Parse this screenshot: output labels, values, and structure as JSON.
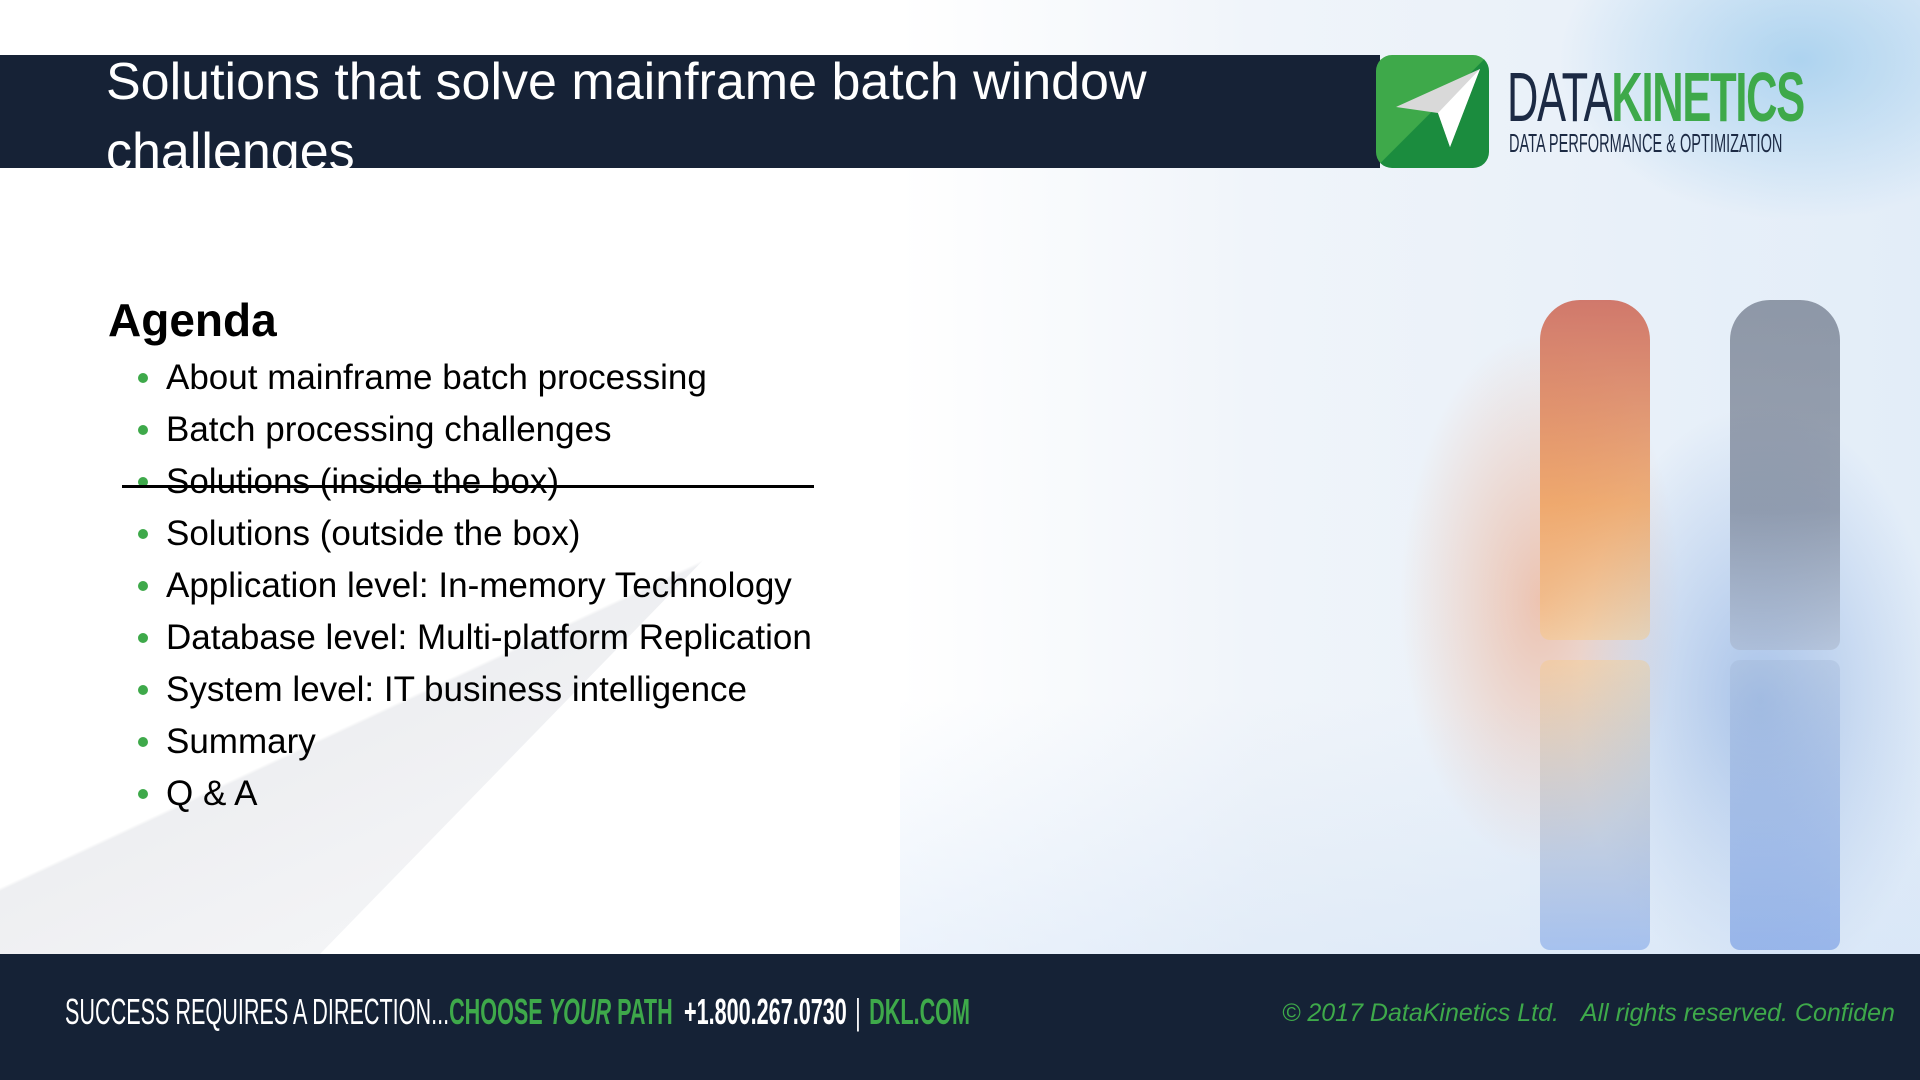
{
  "slide": {
    "title": "Solutions that solve mainframe batch window challenges",
    "colors": {
      "navy": "#162236",
      "brand_green": "#3ea94a",
      "dark_green": "#1b8c3e"
    }
  },
  "logo": {
    "icon": "paper-plane-icon",
    "word_part1": "DATA",
    "word_part2": "KINETICS",
    "tagline": "DATA PERFORMANCE & OPTIMIZATION"
  },
  "agenda": {
    "heading": "Agenda",
    "items": [
      {
        "label": "About mainframe batch processing",
        "struck": false
      },
      {
        "label": "Batch processing challenges",
        "struck": false
      },
      {
        "label": "Solutions (inside the box)",
        "struck": true
      },
      {
        "label": "Solutions (outside the box)",
        "struck": false
      },
      {
        "label": "Application level: In-memory Technology",
        "struck": false
      },
      {
        "label": "Database level: Multi-platform Replication",
        "struck": false
      },
      {
        "label": "System level: IT business intelligence",
        "struck": false
      },
      {
        "label": "Summary",
        "struck": false
      },
      {
        "label": "Q & A",
        "struck": false
      }
    ]
  },
  "footer": {
    "tagline_white": "SUCCESS REQUIRES A DIRECTION...",
    "tagline_green_1": "CHOOSE ",
    "tagline_green_italic": "YOUR",
    "tagline_green_2": " PATH",
    "phone": "+1.800.267.0730",
    "separator": "|",
    "website": "DKL.COM",
    "copyright_1": "© 2017 DataKinetics Ltd.",
    "copyright_2": "All rights reserved. Confiden"
  }
}
